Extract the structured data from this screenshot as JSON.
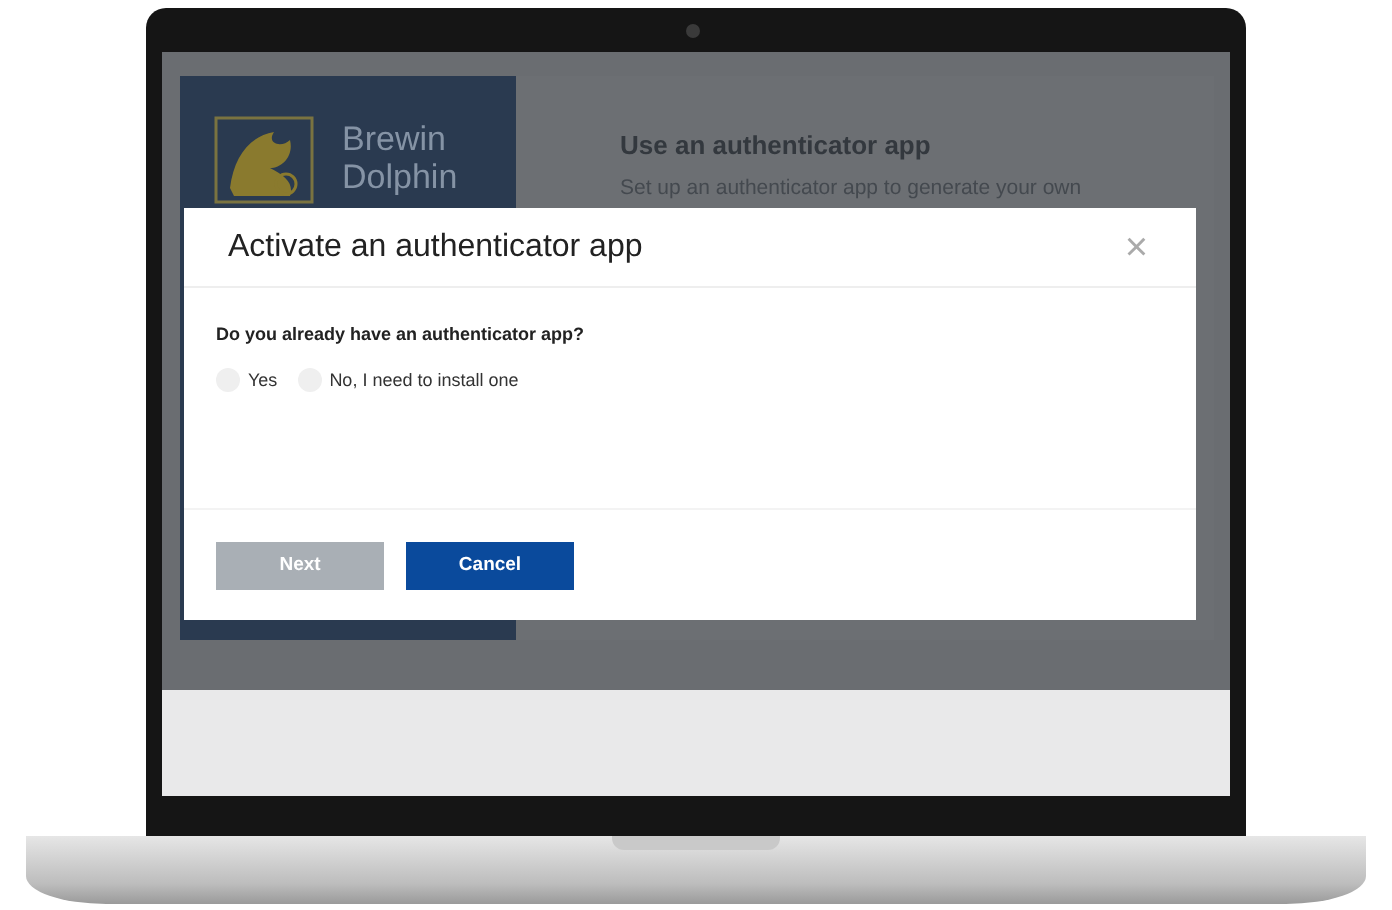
{
  "brand": {
    "name": "Brewin Dolphin"
  },
  "background_page": {
    "heading": "Use an authenticator app",
    "text": "Set up an authenticator app to generate your own"
  },
  "dialog": {
    "title": "Activate an authenticator app",
    "close": "×",
    "question": "Do you already have an authenticator app?",
    "options": [
      {
        "label": "Yes",
        "selected": false
      },
      {
        "label": "No, I need to install one",
        "selected": false
      }
    ],
    "buttons": [
      {
        "label": "Next",
        "disabled": true
      },
      {
        "label": "Cancel",
        "disabled": false
      }
    ]
  }
}
